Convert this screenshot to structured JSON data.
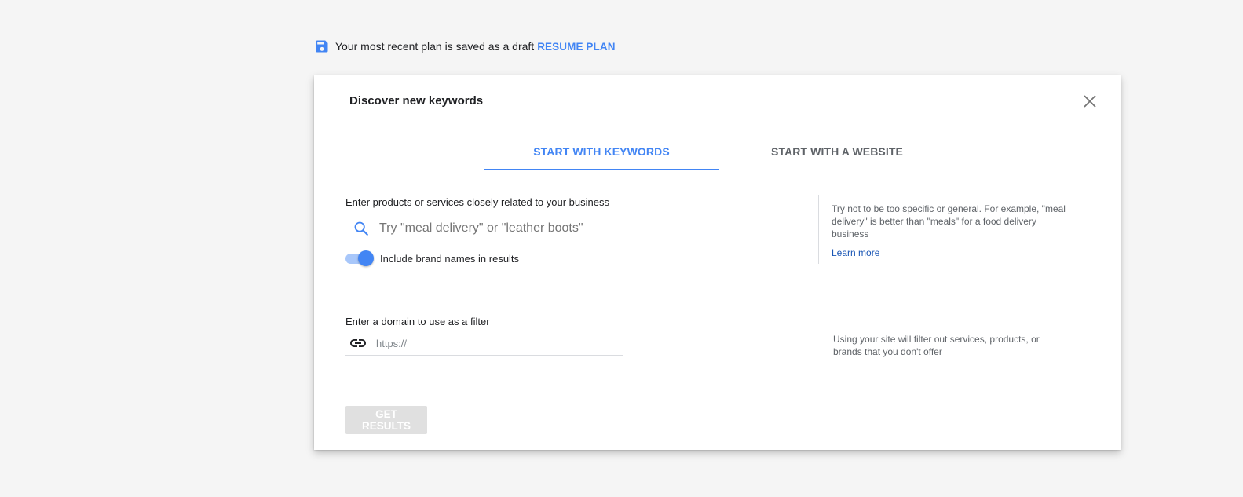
{
  "banner": {
    "message": "Your most recent plan is saved as a draft",
    "resume_label": "RESUME PLAN",
    "icon": "save-icon"
  },
  "dialog": {
    "title": "Discover new keywords",
    "close_icon": "close-icon",
    "tabs": [
      {
        "label": "START WITH KEYWORDS",
        "active": true
      },
      {
        "label": "START WITH A WEBSITE",
        "active": false
      }
    ],
    "keywords": {
      "label": "Enter products or services closely related to your business",
      "placeholder": "Try \"meal delivery\" or \"leather boots\"",
      "value": "",
      "icon": "search-icon",
      "brand_toggle": {
        "label": "Include brand names in results",
        "on": true
      },
      "help_text": "Try not to be too specific or general. For example, \"meal delivery\" is better than \"meals\" for a food delivery business",
      "learn_more": "Learn more"
    },
    "domain": {
      "label": "Enter a domain to use as a filter",
      "placeholder": "https://",
      "value": "",
      "icon": "link-icon",
      "help_text": "Using your site will filter out services, products, or brands that you don't offer"
    },
    "submit_label": "GET RESULTS",
    "submit_enabled": false
  },
  "colors": {
    "accent": "#4285f4",
    "background": "#f5f5f5",
    "disabled_button": "#e0e0e0"
  }
}
